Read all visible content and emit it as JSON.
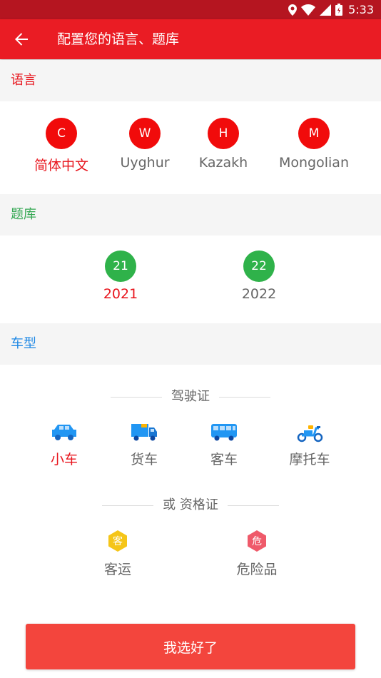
{
  "status_bar": {
    "time": "5:33"
  },
  "app_bar": {
    "title": "配置您的语言、题库"
  },
  "language": {
    "header": "语言",
    "options": [
      {
        "badge": "C",
        "label": "简体中文"
      },
      {
        "badge": "W",
        "label": "Uyghur"
      },
      {
        "badge": "H",
        "label": "Kazakh"
      },
      {
        "badge": "M",
        "label": "Mongolian"
      }
    ]
  },
  "question_bank": {
    "header": "题库",
    "options": [
      {
        "badge": "21",
        "label": "2021"
      },
      {
        "badge": "22",
        "label": "2022"
      }
    ]
  },
  "vehicle": {
    "header": "车型",
    "license_divider": "驾驶证",
    "licenses": [
      {
        "label": "小车",
        "icon": "car-icon"
      },
      {
        "label": "货车",
        "icon": "truck-icon"
      },
      {
        "label": "客车",
        "icon": "bus-icon"
      },
      {
        "label": "摩托车",
        "icon": "scooter-icon"
      }
    ],
    "cert_divider": "或 资格证",
    "certs": [
      {
        "badge": "客",
        "label": "客运",
        "color": "#f5c518"
      },
      {
        "badge": "危",
        "label": "危险品",
        "color": "#ef5a6a"
      }
    ]
  },
  "confirm_button": "我选好了",
  "colors": {
    "primary": "#ea1c24",
    "status_bar": "#b51520",
    "vehicle_blue": "#2196f3"
  }
}
